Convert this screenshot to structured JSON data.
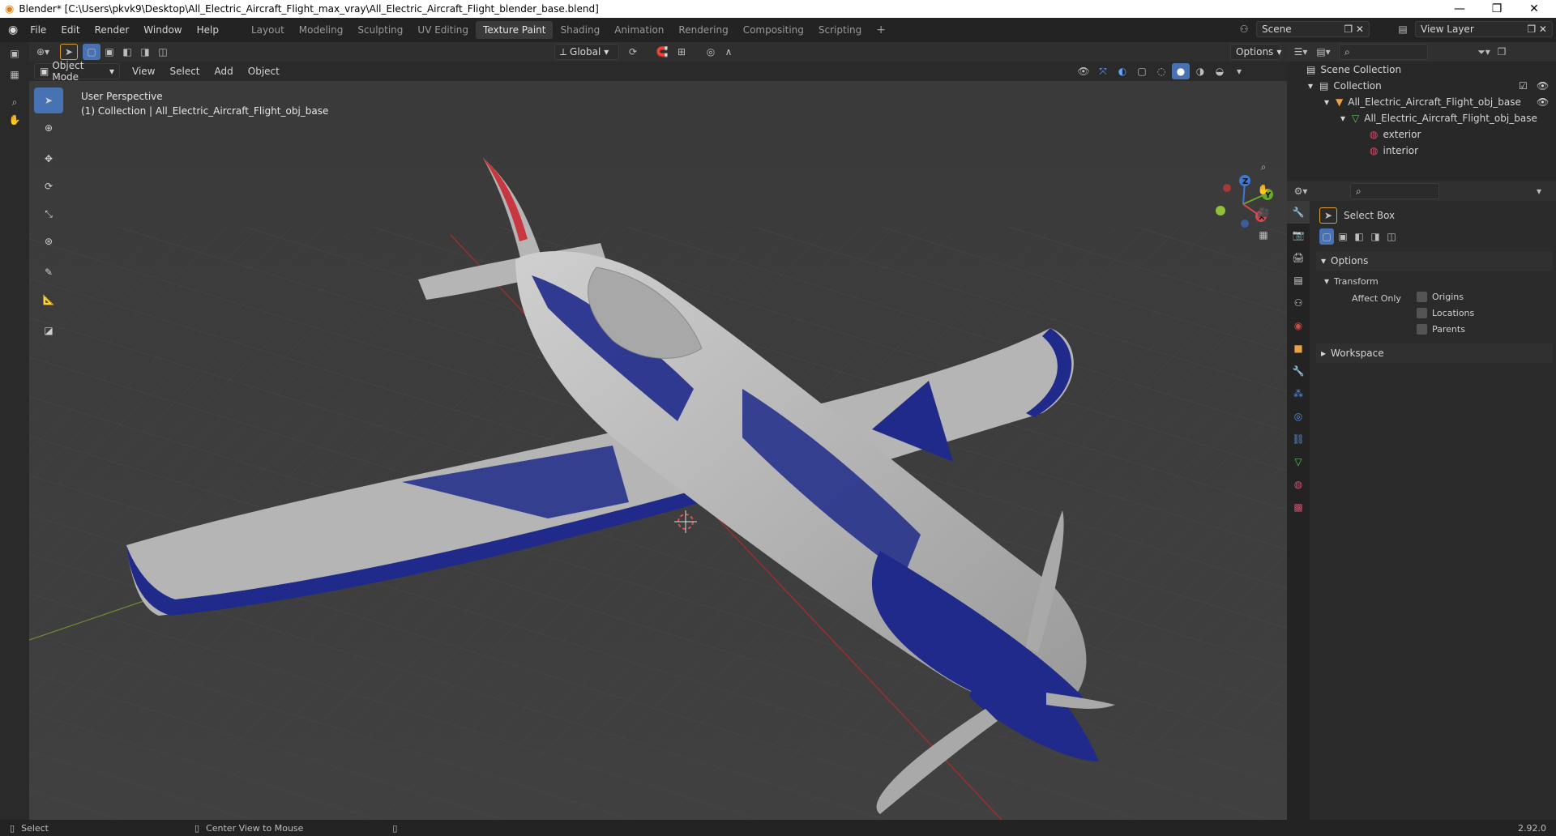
{
  "window": {
    "title": "Blender* [C:\\Users\\pkvk9\\Desktop\\All_Electric_Aircraft_Flight_max_vray\\All_Electric_Aircraft_Flight_blender_base.blend]"
  },
  "menu": [
    "File",
    "Edit",
    "Render",
    "Window",
    "Help"
  ],
  "workspaces": [
    {
      "label": "Layout",
      "active": false
    },
    {
      "label": "Modeling",
      "active": false
    },
    {
      "label": "Sculpting",
      "active": false
    },
    {
      "label": "UV Editing",
      "active": false
    },
    {
      "label": "Texture Paint",
      "active": true
    },
    {
      "label": "Shading",
      "active": false
    },
    {
      "label": "Animation",
      "active": false
    },
    {
      "label": "Rendering",
      "active": false
    },
    {
      "label": "Compositing",
      "active": false
    },
    {
      "label": "Scripting",
      "active": false
    }
  ],
  "scene": {
    "name": "Scene",
    "view_layer": "View Layer"
  },
  "viewport_header": {
    "transform_orientation": "Global",
    "options_label": "Options",
    "mode": "Object Mode",
    "menus": [
      "View",
      "Select",
      "Add",
      "Object"
    ]
  },
  "viewport": {
    "perspective": "User Perspective",
    "collection_info": "(1) Collection | All_Electric_Aircraft_Flight_obj_base",
    "gizmo": {
      "x": "X",
      "y": "Y",
      "z": "Z"
    }
  },
  "outliner": {
    "rows": [
      {
        "label": "Scene Collection"
      },
      {
        "label": "Collection"
      },
      {
        "label": "All_Electric_Aircraft_Flight_obj_base"
      },
      {
        "label": "All_Electric_Aircraft_Flight_obj_base"
      },
      {
        "label": "exterior"
      },
      {
        "label": "interior"
      }
    ]
  },
  "properties": {
    "tool_name": "Select Box",
    "options_panel": "Options",
    "transform_panel": "Transform",
    "affect_only": "Affect Only",
    "checks": [
      "Origins",
      "Locations",
      "Parents"
    ],
    "workspace_panel": "Workspace"
  },
  "status": {
    "left": "Select",
    "middle": "Center View to Mouse",
    "version": "2.92.0"
  },
  "colors": {
    "accent": "#4772b3",
    "plane_blue": "#1f2a8a",
    "plane_grey": "#b9b9b9"
  }
}
